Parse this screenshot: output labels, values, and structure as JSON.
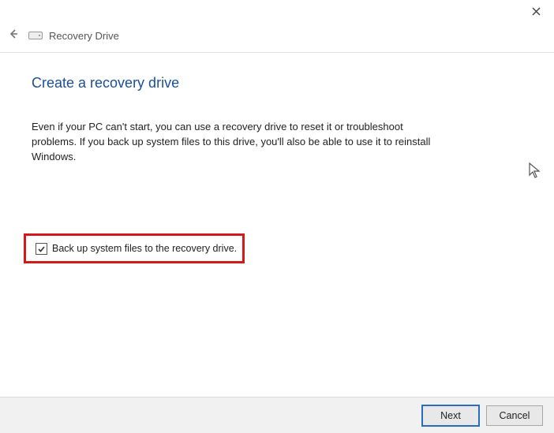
{
  "window": {
    "title": "Recovery Drive"
  },
  "page": {
    "heading": "Create a recovery drive",
    "body": "Even if your PC can't start, you can use a recovery drive to reset it or troubleshoot problems. If you back up system files to this drive, you'll also be able to use it to reinstall Windows."
  },
  "checkbox": {
    "label": "Back up system files to the recovery drive.",
    "checked": true
  },
  "footer": {
    "next": "Next",
    "cancel": "Cancel"
  }
}
